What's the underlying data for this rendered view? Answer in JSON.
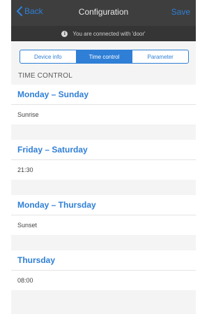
{
  "navbar": {
    "back_label": "Back",
    "title": "Configuration",
    "save_label": "Save"
  },
  "status": {
    "icon": "info-icon",
    "text": "You are connected with 'door'"
  },
  "tabs": [
    {
      "label": "Device info",
      "active": false
    },
    {
      "label": "Time control",
      "active": true
    },
    {
      "label": "Parameter",
      "active": false
    }
  ],
  "section": {
    "header": "TIME CONTROL"
  },
  "entries": [
    {
      "title": "Monday – Sunday",
      "value": "Sunrise"
    },
    {
      "title": "Friday – Saturday",
      "value": "21:30"
    },
    {
      "title": "Monday – Thursday",
      "value": "Sunset"
    },
    {
      "title": "Thursday",
      "value": "08:00"
    }
  ],
  "colors": {
    "accent": "#2f7fd6",
    "navbar": "#3e3e3e",
    "status_bar": "#353535"
  }
}
